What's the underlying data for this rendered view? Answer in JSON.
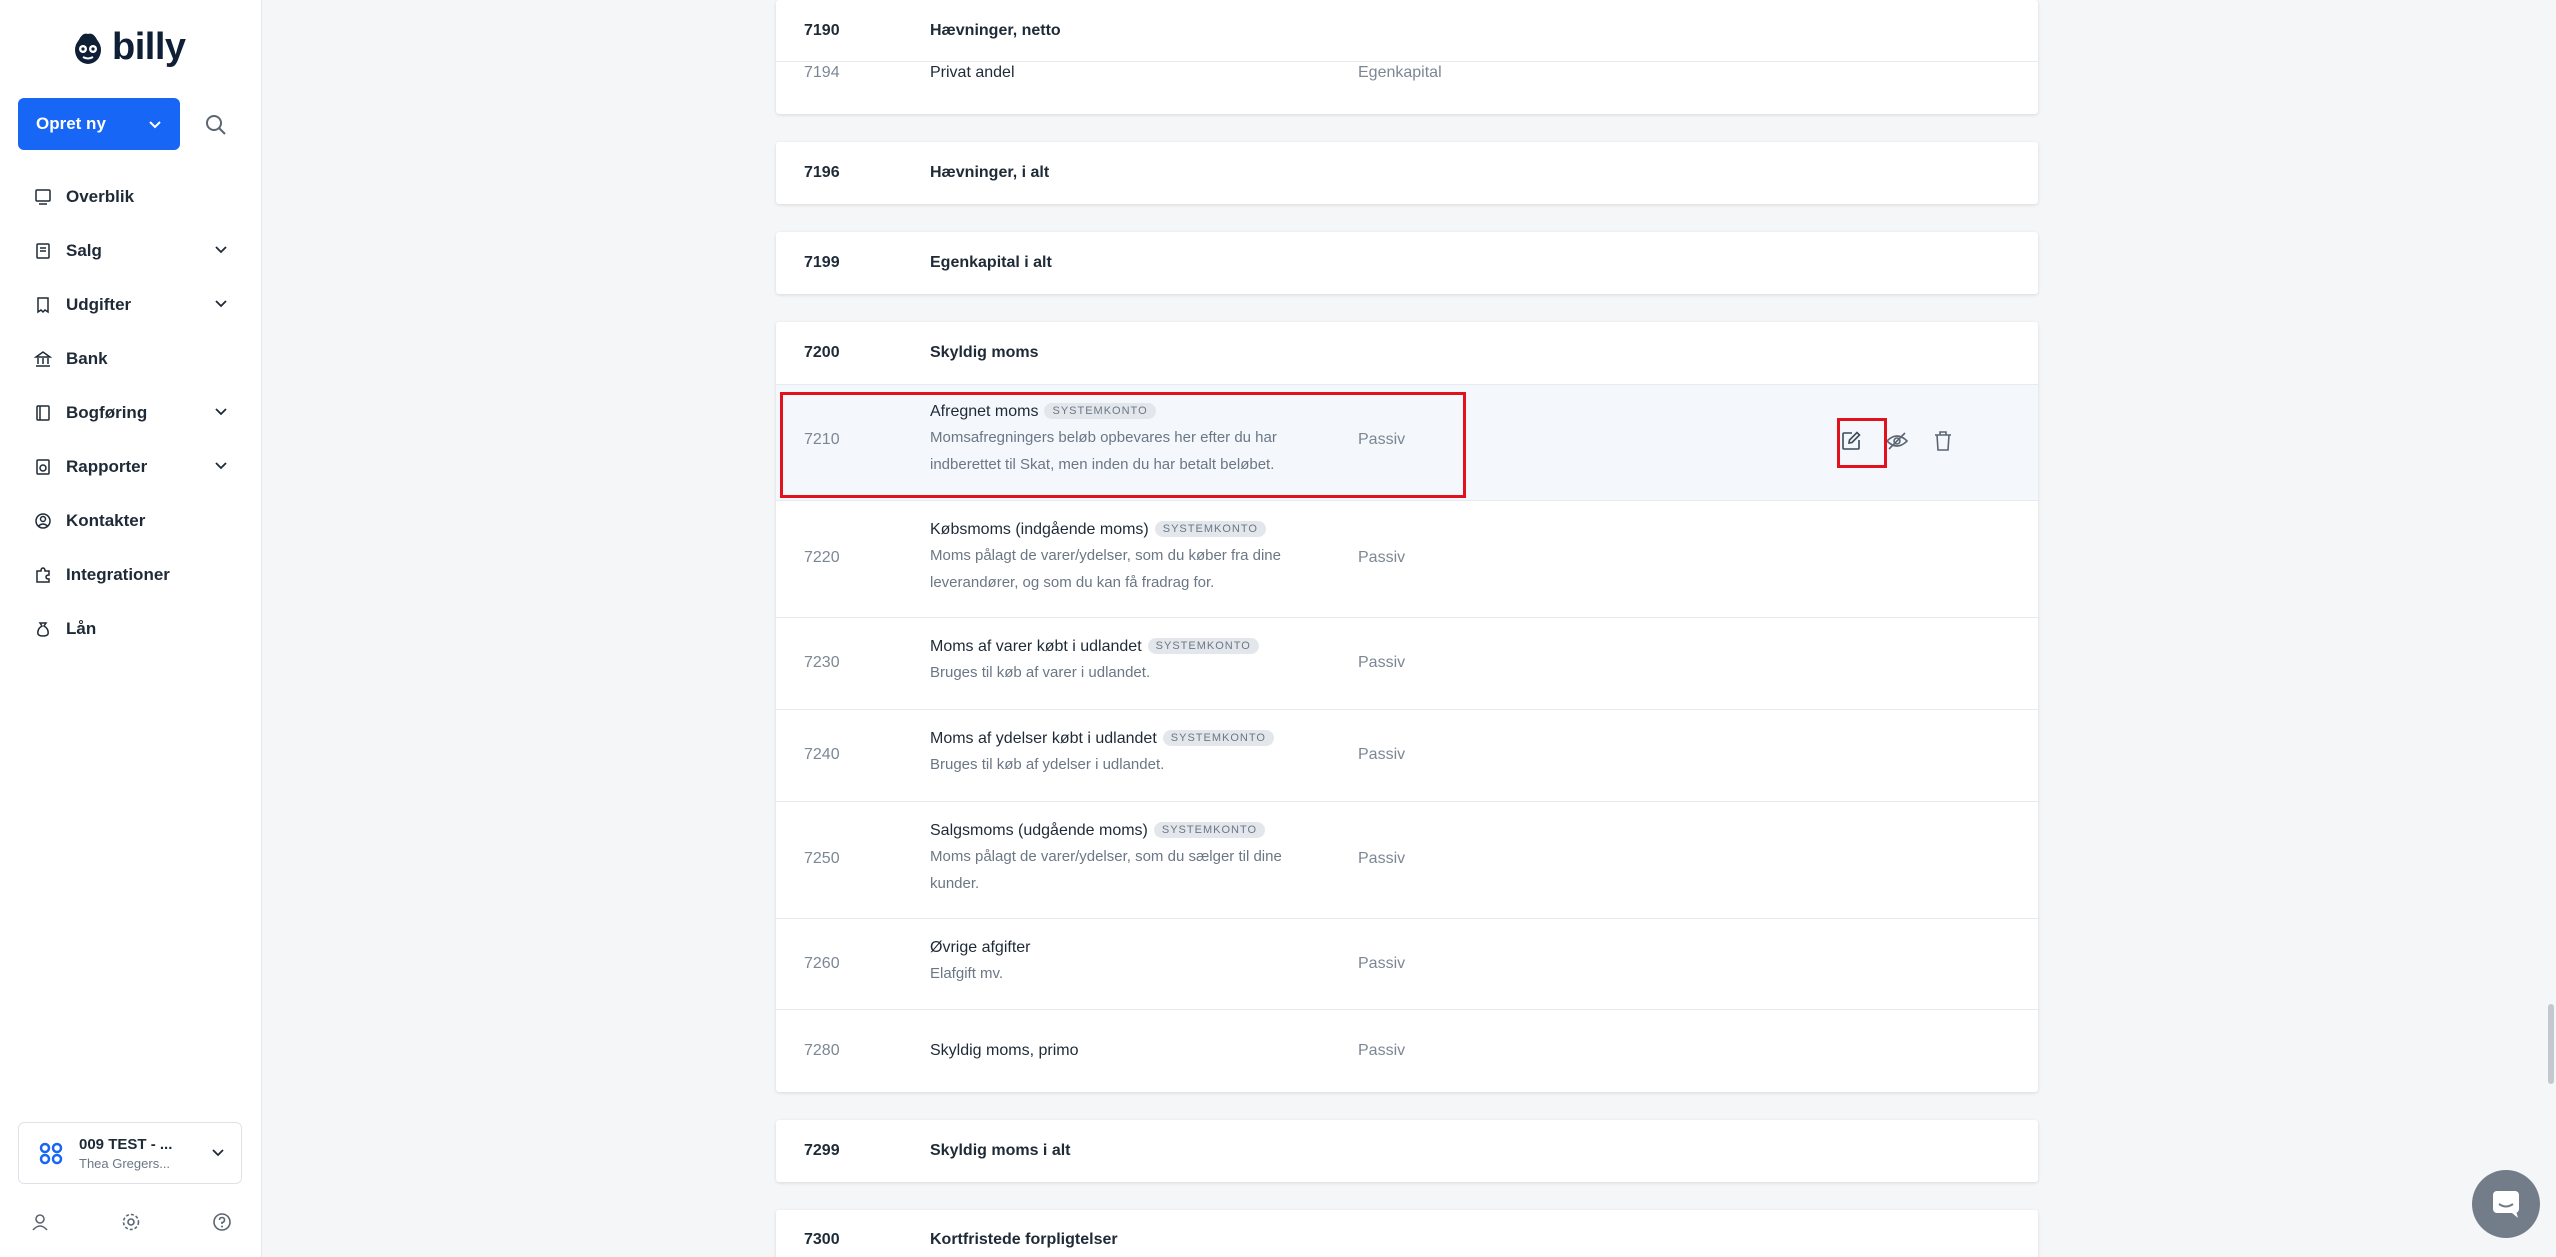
{
  "app": {
    "logo_text": "billy"
  },
  "sidebar": {
    "create_label": "Opret ny",
    "items": [
      {
        "label": "Overblik",
        "icon": "dashboard-icon",
        "expandable": false
      },
      {
        "label": "Salg",
        "icon": "invoice-icon",
        "expandable": true
      },
      {
        "label": "Udgifter",
        "icon": "receipt-icon",
        "expandable": true
      },
      {
        "label": "Bank",
        "icon": "bank-icon",
        "expandable": false
      },
      {
        "label": "Bogføring",
        "icon": "ledger-icon",
        "expandable": true
      },
      {
        "label": "Rapporter",
        "icon": "report-icon",
        "expandable": true
      },
      {
        "label": "Kontakter",
        "icon": "contacts-icon",
        "expandable": false
      },
      {
        "label": "Integrationer",
        "icon": "puzzle-icon",
        "expandable": false
      },
      {
        "label": "Lån",
        "icon": "loan-icon",
        "expandable": false
      }
    ],
    "org": {
      "name": "009 TEST - ...",
      "user": "Thea Gregers..."
    }
  },
  "accounts": {
    "badge": "SYSTEMKONTO",
    "top_block": [
      {
        "number": "7190",
        "name": "Hævninger, netto",
        "bold": true
      },
      {
        "number": "7194",
        "name": "Privat andel",
        "type": "Egenkapital"
      }
    ],
    "sum_7196": {
      "number": "7196",
      "name": "Hævninger, i alt"
    },
    "sum_7199": {
      "number": "7199",
      "name": "Egenkapital i alt"
    },
    "header_7200": {
      "number": "7200",
      "name": "Skyldig moms"
    },
    "rows": [
      {
        "number": "7210",
        "name": "Afregnet moms",
        "system": true,
        "desc1": "Momsafregningers beløb opbevares her efter du har",
        "desc2": "indberettet til Skat, men inden du har betalt beløbet.",
        "type": "Passiv"
      },
      {
        "number": "7220",
        "name": "Købsmoms (indgående moms)",
        "system": true,
        "desc1": "Moms pålagt de varer/ydelser, som du køber fra dine",
        "desc2": "leverandører, og som du kan få fradrag for.",
        "type": "Passiv"
      },
      {
        "number": "7230",
        "name": "Moms af varer købt i udlandet",
        "system": true,
        "desc1": "Bruges til køb af varer i udlandet.",
        "desc2": "",
        "type": "Passiv"
      },
      {
        "number": "7240",
        "name": "Moms af ydelser købt i udlandet",
        "system": true,
        "desc1": "Bruges til køb af ydelser i udlandet.",
        "desc2": "",
        "type": "Passiv"
      },
      {
        "number": "7250",
        "name": "Salgsmoms (udgående moms)",
        "system": true,
        "desc1": "Moms pålagt de varer/ydelser, som du sælger til dine",
        "desc2": "kunder.",
        "type": "Passiv"
      },
      {
        "number": "7260",
        "name": "Øvrige afgifter",
        "system": false,
        "desc1": "Elafgift mv.",
        "desc2": "",
        "type": "Passiv"
      },
      {
        "number": "7280",
        "name": "Skyldig moms, primo",
        "system": false,
        "desc1": "",
        "desc2": "",
        "type": "Passiv"
      }
    ],
    "sum_7299": {
      "number": "7299",
      "name": "Skyldig moms i alt"
    },
    "header_7300": {
      "number": "7300",
      "name": "Kortfristede forpligtelser"
    }
  },
  "colors": {
    "accent": "#1766f5",
    "highlight": "#e1121b"
  }
}
